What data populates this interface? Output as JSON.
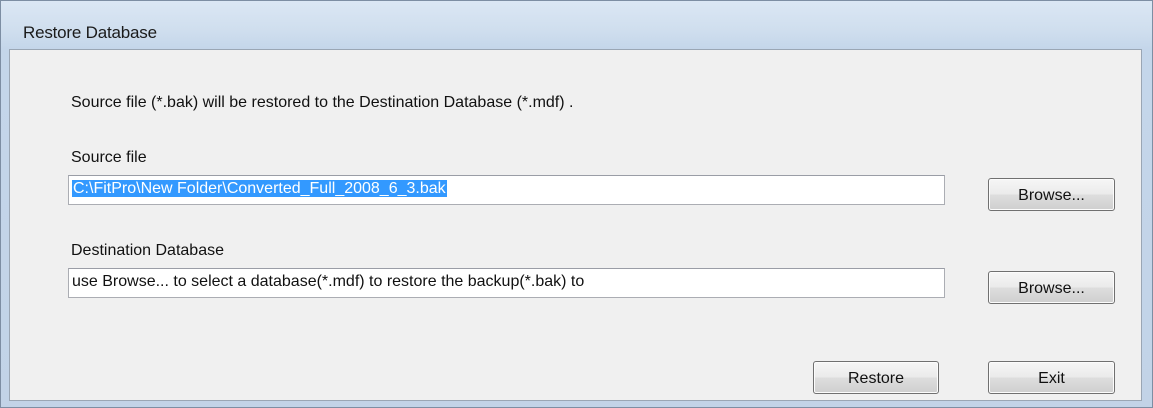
{
  "window": {
    "title": "Restore Database"
  },
  "dialog": {
    "description": "Source file (*.bak) will be restored to the Destination Database (*.mdf) .",
    "source": {
      "label": "Source file",
      "value": "C:\\FitPro\\New Folder\\Converted_Full_2008_6_3.bak",
      "browse_label": "Browse..."
    },
    "destination": {
      "label": "Destination Database",
      "value": "use Browse... to select a database(*.mdf) to restore the backup(*.bak) to",
      "browse_label": "Browse..."
    },
    "restore_label": "Restore",
    "exit_label": "Exit"
  },
  "colors": {
    "selection": "#3399ff",
    "window_frame": "#c4d6ea",
    "client_background": "#f0f0f0"
  }
}
